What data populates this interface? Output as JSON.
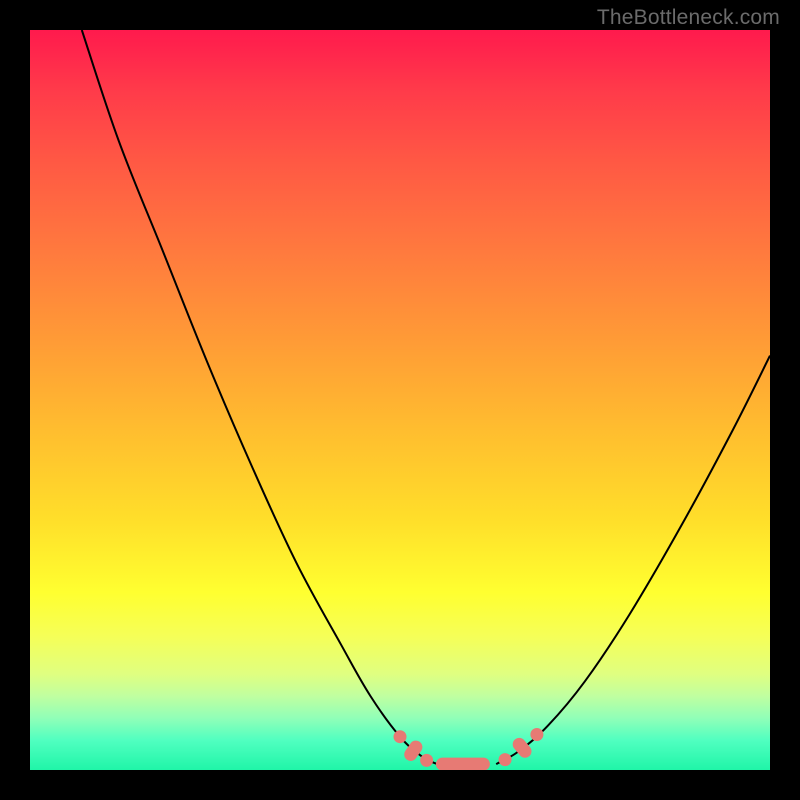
{
  "attribution_text": "TheBottleneck.com",
  "colors": {
    "frame_bg": "#000000",
    "curve": "#000000",
    "markers": "#e77a74",
    "gradient_top": "#ff1a4d",
    "gradient_bottom": "#20f5a8"
  },
  "chart_data": {
    "type": "line",
    "title": "",
    "xlabel": "",
    "ylabel": "",
    "xlim": [
      0,
      100
    ],
    "ylim": [
      0,
      100
    ],
    "series": [
      {
        "name": "left-curve",
        "x": [
          7,
          12,
          18,
          24,
          30,
          36,
          42,
          46,
          50,
          53,
          55
        ],
        "y": [
          100,
          85,
          70,
          55,
          41,
          28,
          17,
          10,
          4.5,
          1.8,
          0.8
        ]
      },
      {
        "name": "right-curve",
        "x": [
          63,
          66,
          70,
          75,
          81,
          88,
          95,
          100
        ],
        "y": [
          0.8,
          2.5,
          6,
          12,
          21,
          33,
          46,
          56
        ]
      },
      {
        "name": "flat-bottom",
        "x": [
          55,
          63
        ],
        "y": [
          0.8,
          0.8
        ]
      }
    ],
    "markers": [
      {
        "shape": "dot",
        "x": 50.0,
        "y": 4.5
      },
      {
        "shape": "pill",
        "x": 51.8,
        "y": 2.6,
        "angle": -55
      },
      {
        "shape": "dot",
        "x": 53.6,
        "y": 1.3
      },
      {
        "shape": "pill",
        "x": 58.5,
        "y": 0.8,
        "angle": 0,
        "long": true
      },
      {
        "shape": "dot",
        "x": 64.2,
        "y": 1.4
      },
      {
        "shape": "pill",
        "x": 66.5,
        "y": 3.0,
        "angle": 50
      },
      {
        "shape": "dot",
        "x": 68.5,
        "y": 4.8
      }
    ]
  }
}
